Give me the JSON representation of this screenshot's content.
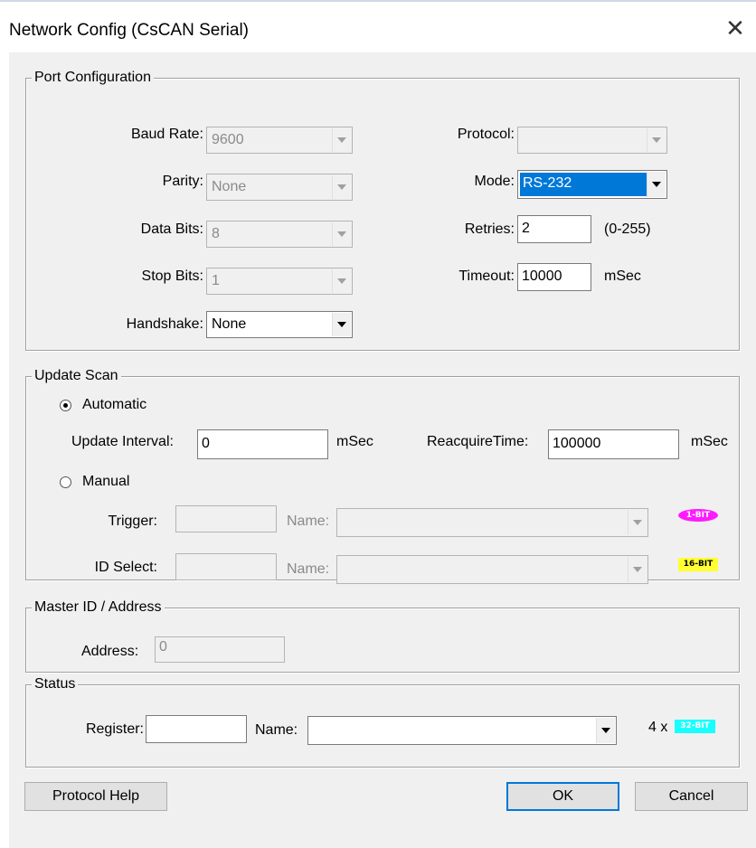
{
  "window": {
    "title": "Network Config (CsCAN Serial)",
    "close_glyph": "✕"
  },
  "port": {
    "legend": "Port Configuration",
    "baud": {
      "label": "Baud Rate:",
      "value": "9600"
    },
    "parity": {
      "label": "Parity:",
      "value": "None"
    },
    "databits": {
      "label": "Data Bits:",
      "value": "8"
    },
    "stopbits": {
      "label": "Stop Bits:",
      "value": "1"
    },
    "handshake": {
      "label": "Handshake:",
      "value": "None"
    },
    "protocol": {
      "label": "Protocol:",
      "value": ""
    },
    "mode": {
      "label": "Mode:",
      "value": "RS-232"
    },
    "retries": {
      "label": "Retries:",
      "value": "2",
      "range": "(0-255)"
    },
    "timeout": {
      "label": "Timeout:",
      "value": "10000",
      "unit": "mSec"
    }
  },
  "scan": {
    "legend": "Update Scan",
    "automatic_label": "Automatic",
    "automatic_selected": true,
    "interval": {
      "label": "Update Interval:",
      "value": "0",
      "unit": "mSec"
    },
    "reacquire": {
      "label": "ReacquireTime:",
      "value": "100000",
      "unit": "mSec"
    },
    "manual_label": "Manual",
    "trigger": {
      "label": "Trigger:",
      "value": "",
      "name_label": "Name:",
      "name_value": "",
      "badge": "1-BIT"
    },
    "idselect": {
      "label": "ID Select:",
      "value": "",
      "name_label": "Name:",
      "name_value": "",
      "badge": "16-BIT"
    }
  },
  "master": {
    "legend": "Master ID / Address",
    "address": {
      "label": "Address:",
      "value": "0"
    }
  },
  "status": {
    "legend": "Status",
    "register": {
      "label": "Register:",
      "value": ""
    },
    "name": {
      "label": "Name:",
      "value": ""
    },
    "multiplier": "4 x",
    "badge": "32-BIT"
  },
  "buttons": {
    "help": "Protocol Help",
    "ok": "OK",
    "cancel": "Cancel"
  },
  "colors": {
    "selection": "#0078d7",
    "badge_1bit": "#ff1aff",
    "badge_16bit": "#ffff33",
    "badge_32bit": "#19ffff"
  }
}
